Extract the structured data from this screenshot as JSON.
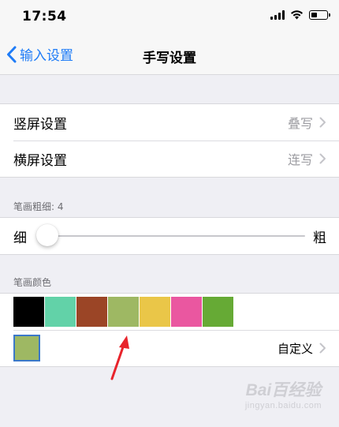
{
  "status_bar": {
    "time": "17:54",
    "icons": [
      "signal-icon",
      "wifi-icon",
      "battery-icon"
    ]
  },
  "nav": {
    "back_label": "输入设置",
    "title": "手写设置"
  },
  "settings": [
    {
      "label": "竖屏设置",
      "value": "叠写"
    },
    {
      "label": "横屏设置",
      "value": "连写"
    }
  ],
  "stroke_width": {
    "header": "笔画粗细: 4",
    "min_label": "细",
    "max_label": "粗",
    "level": 4
  },
  "stroke_color": {
    "header": "笔画颜色",
    "swatches": [
      "#000000",
      "#62d2a8",
      "#9b4526",
      "#9eb863",
      "#eac648",
      "#ea57a0",
      "#66aa35"
    ],
    "selected_color": "#9eb863",
    "custom_label": "自定义"
  },
  "watermark": {
    "brand": "Bai百经验",
    "sub": "jingyan.baidu.com"
  },
  "colors": {
    "accent": "#1f7cf7",
    "annotation_arrow": "#e8242c"
  }
}
